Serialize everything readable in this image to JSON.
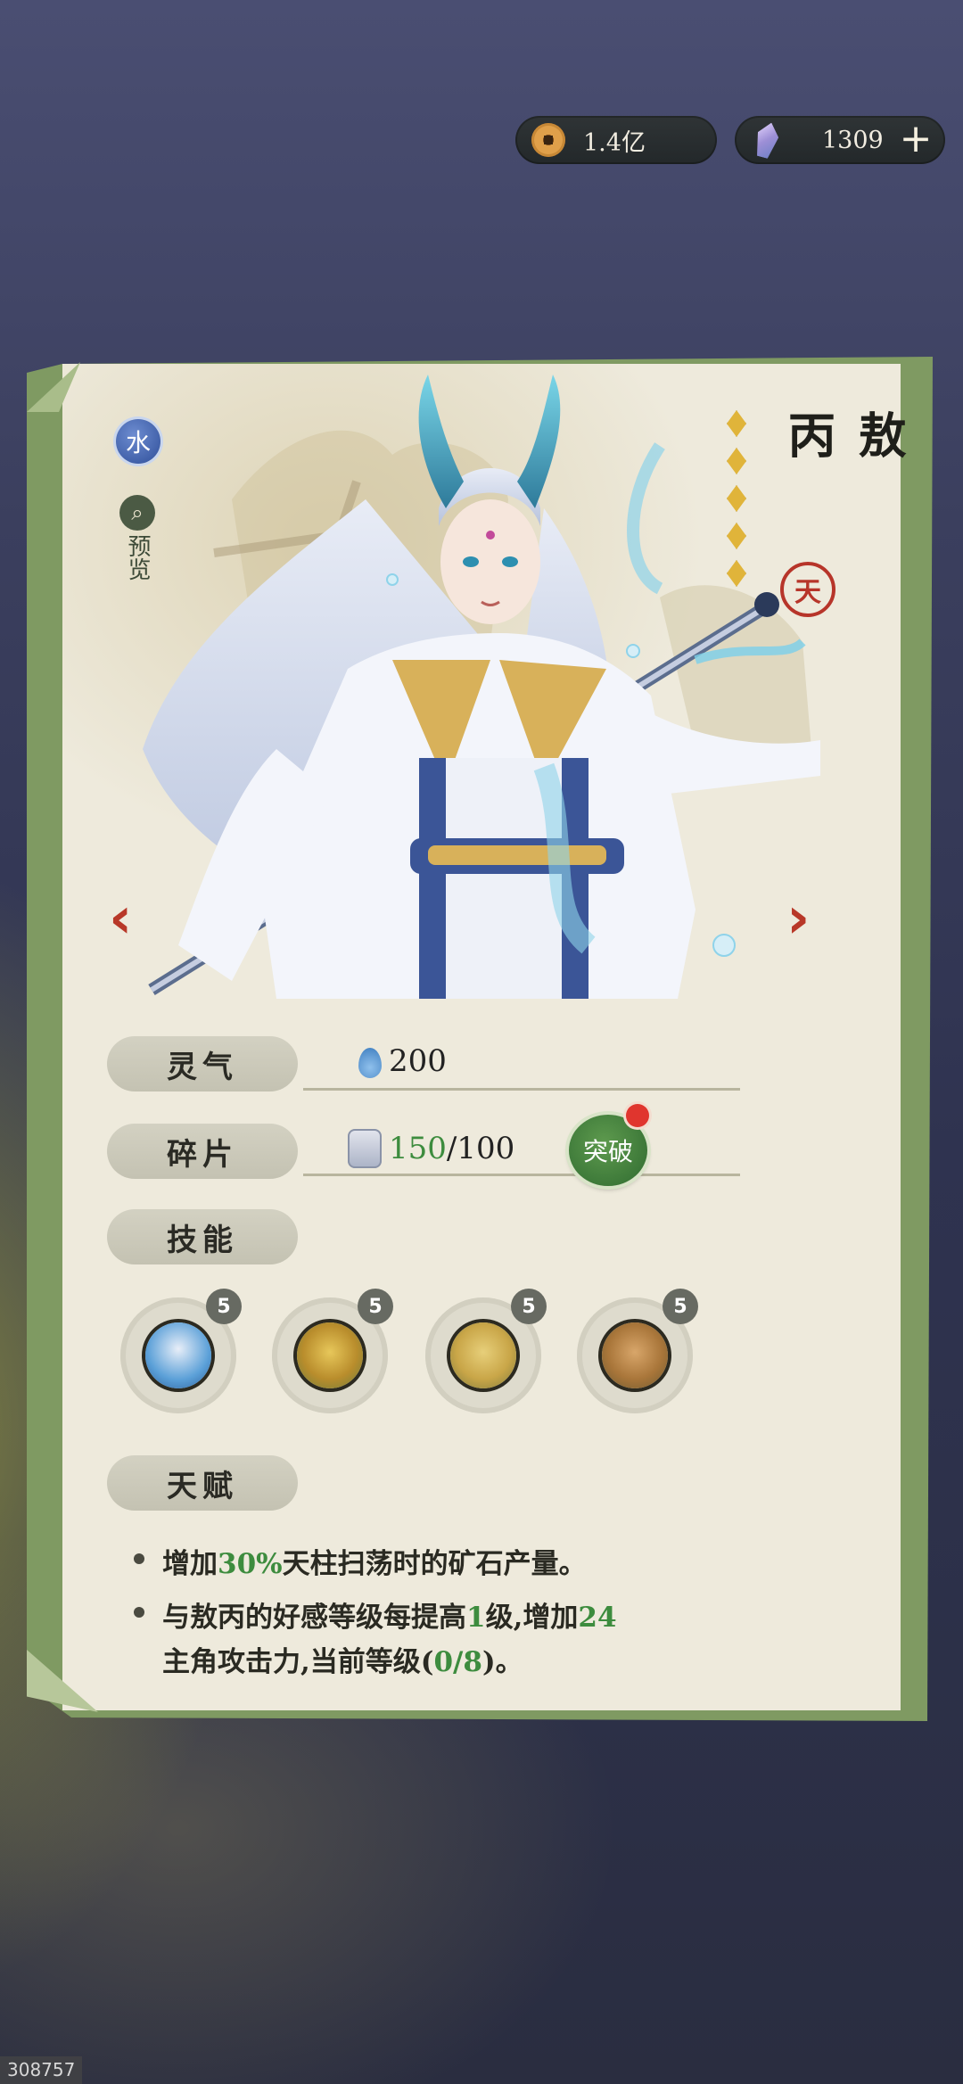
{
  "currency": {
    "coins": "1.4亿",
    "gems": "1309",
    "add_symbol": "+"
  },
  "hero": {
    "element": "水",
    "preview_label": "预览",
    "name": "敖丙",
    "star_count": 5,
    "rank_seal": "天"
  },
  "stats": {
    "spirit_label": "灵气",
    "spirit_value": "200",
    "fragment_label": "碎片",
    "fragment_have": "150",
    "fragment_need": "/100",
    "breakthrough_label": "突破"
  },
  "skills": {
    "label": "技能",
    "items": [
      {
        "level": "5",
        "icon": "hero-portrait-icon"
      },
      {
        "level": "5",
        "icon": "golden-altar-icon"
      },
      {
        "level": "5",
        "icon": "ground-pick-icon"
      },
      {
        "level": "5",
        "icon": "scroll-bucket-icon"
      }
    ]
  },
  "talent": {
    "label": "天赋",
    "line1": [
      "增加",
      "30%",
      "天柱扫荡时的矿石产量。"
    ],
    "line2": [
      "与敖丙的好感等级每提高",
      "1",
      "级,增加",
      "24"
    ],
    "line3": [
      "主角攻击力,当前等级(",
      "0/8",
      ")。"
    ]
  },
  "footer_id": "308757",
  "colors": {
    "accent_green": "#3d8c3e",
    "card_border": "#7f9a62",
    "paper": "#eeeadc",
    "nav_arrow": "#b83828"
  }
}
